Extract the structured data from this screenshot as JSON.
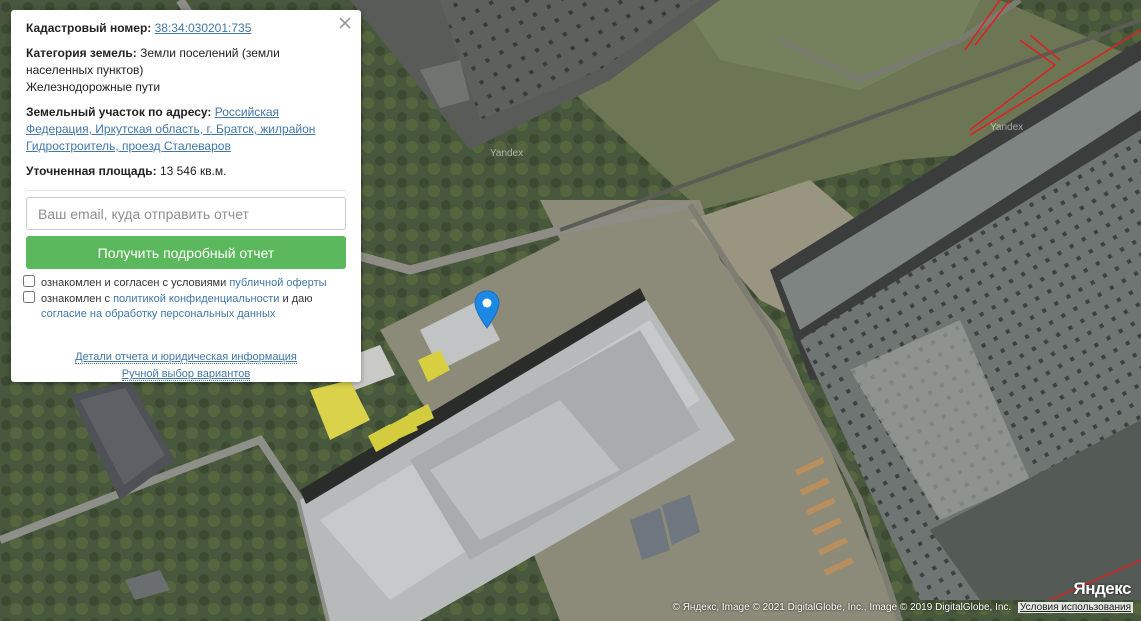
{
  "popup": {
    "cadastral_label": "Кадастровый номер:",
    "cadastral_number": "38:34:030201:735",
    "category_label": "Категория земель:",
    "category_value": "Земли поселений (земли населенных пунктов)",
    "usage": "Железнодорожные пути",
    "address_label": "Земельный участок по адресу:",
    "address_value": "Российская Федерация, Иркутская область, г. Братск, жилрайон Гидростроитель, проезд Сталеваров",
    "area_label": "Уточненная площадь:",
    "area_value": "13 546 кв.м.",
    "email_placeholder": "Ваш email, куда отправить отчет",
    "report_button": "Получить подробный отчет",
    "consent1_text": "ознакомлен и согласен с условиями",
    "consent1_link": "публичной оферты",
    "consent2_text": "ознакомлен с",
    "consent2_link": "политикой конфиденциальности",
    "consent2_and": "и даю",
    "consent2_link2": "согласие на обработку персональных данных",
    "details_link": "Детали отчета и юридическая информация",
    "manual_link": "Ручной выбор вариантов"
  },
  "map": {
    "watermark_1": "Yandex",
    "watermark_2": "Yandex",
    "logo": "Яндекс",
    "copyright": "© Яндекс, Image © 2021 DigitalGlobe, Inc., Image © 2019 DigitalGlobe, Inc.",
    "terms_link": "Условия использования",
    "marker_color": "#1e88e5",
    "button_color": "#5cb85c",
    "link_color": "#4277a8",
    "boundary_color": "#e02020"
  }
}
